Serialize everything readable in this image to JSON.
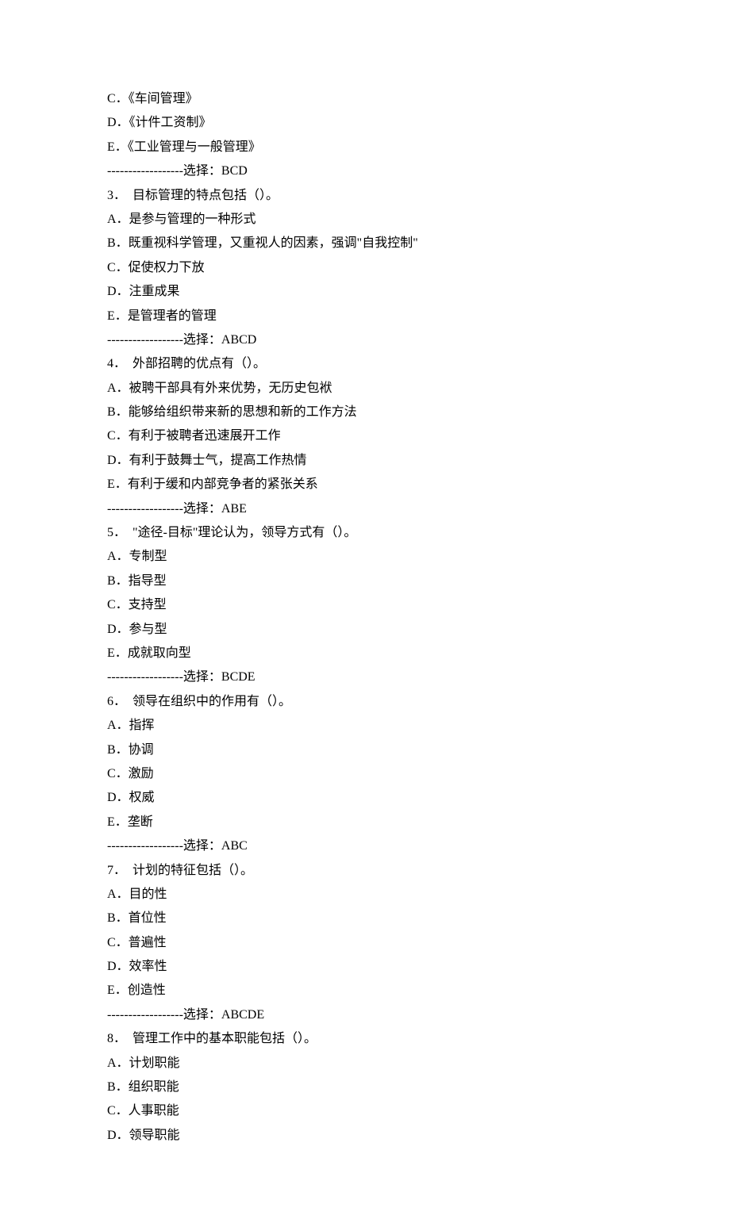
{
  "lines": [
    "C．《车间管理》",
    "D．《计件工资制》",
    "E．《工业管理与一般管理》",
    "------------------选择：BCD",
    "3．  目标管理的特点包括（）。",
    "A．是参与管理的一种形式",
    "B．既重视科学管理，又重视人的因素，强调\"自我控制\"",
    "C．促使权力下放",
    "D．注重成果",
    "E．是管理者的管理",
    "------------------选择：ABCD",
    "4．  外部招聘的优点有（）。",
    "A．被聘干部具有外来优势，无历史包袱",
    "B．能够给组织带来新的思想和新的工作方法",
    "C．有利于被聘者迅速展开工作",
    "D．有利于鼓舞士气，提高工作热情",
    "E．有利于缓和内部竞争者的紧张关系",
    "------------------选择：ABE",
    "5．  \"途径-目标\"理论认为，领导方式有（）。",
    "A．专制型",
    "B．指导型",
    "C．支持型",
    "D．参与型",
    "E．成就取向型",
    "------------------选择：BCDE",
    "6．  领导在组织中的作用有（）。",
    "A．指挥",
    "B．协调",
    "C．激励",
    "D．权威",
    "E．垄断",
    "------------------选择：ABC",
    "7．  计划的特征包括（）。",
    "A．目的性",
    "B．首位性",
    "C．普遍性",
    "D．效率性",
    "E．创造性",
    "------------------选择：ABCDE",
    "8．  管理工作中的基本职能包括（）。",
    "A．计划职能",
    "B．组织职能",
    "C．人事职能",
    "D．领导职能"
  ]
}
